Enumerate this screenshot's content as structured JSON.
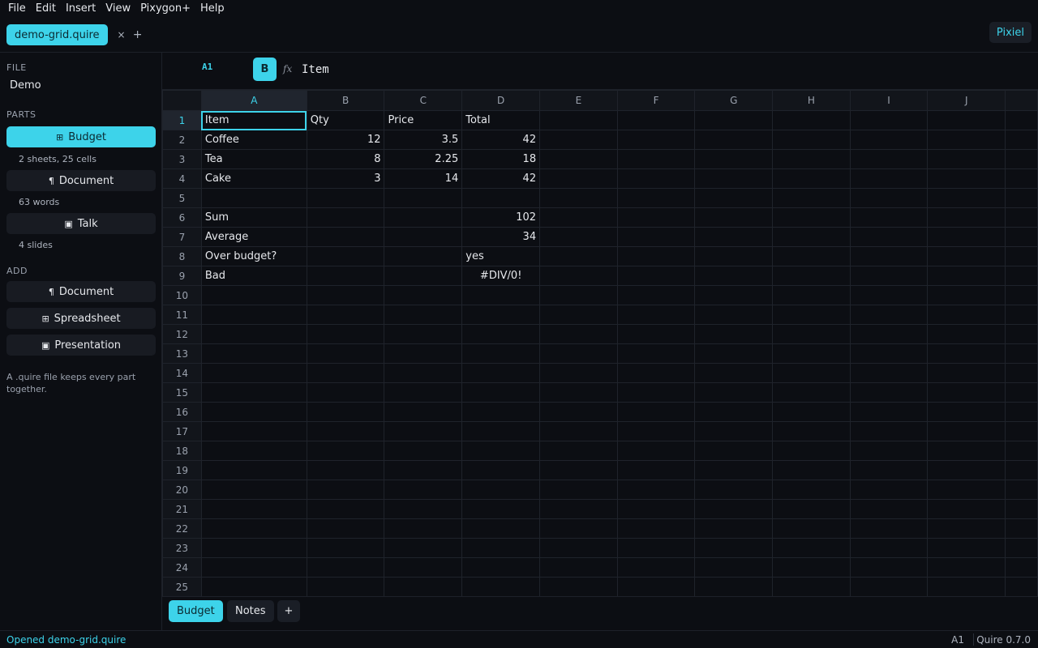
{
  "menubar": {
    "items": [
      "File",
      "Edit",
      "Insert",
      "View",
      "Pixygon+",
      "Help"
    ]
  },
  "tabs": {
    "active_tab": "demo-grid.quire",
    "close_symbol": "×",
    "add_symbol": "+",
    "user_label": "Pixiel"
  },
  "sidebar": {
    "file_label": "FILE",
    "file_name": "Demo",
    "parts_label": "PARTS",
    "parts": [
      {
        "label": "Budget",
        "icon": "spreadsheet-icon",
        "glyph": "⊞",
        "meta": "2 sheets, 25 cells",
        "active": true
      },
      {
        "label": "Document",
        "icon": "paragraph-icon",
        "glyph": "¶",
        "meta": "63 words",
        "active": false
      },
      {
        "label": "Talk",
        "icon": "presentation-icon",
        "glyph": "▣",
        "meta": "4 slides",
        "active": false
      }
    ],
    "add_label": "ADD",
    "add_items": [
      {
        "label": "Document",
        "icon": "paragraph-icon",
        "glyph": "¶"
      },
      {
        "label": "Spreadsheet",
        "icon": "spreadsheet-icon",
        "glyph": "⊞"
      },
      {
        "label": "Presentation",
        "icon": "presentation-icon",
        "glyph": "▣"
      }
    ],
    "note": "A .quire file keeps every part together."
  },
  "formula_bar": {
    "cell_ref": "A1",
    "bold_label": "B",
    "fx_label": "fx",
    "value": "Item"
  },
  "grid": {
    "columns": [
      "A",
      "B",
      "C",
      "D",
      "E",
      "F",
      "G",
      "H",
      "I",
      "J"
    ],
    "selected_column": "A",
    "selected_row": 1,
    "rows": [
      [
        "Item",
        "Qty",
        "Price",
        "Total",
        "",
        "",
        "",
        "",
        "",
        ""
      ],
      [
        "Coffee",
        "12",
        "3.5",
        "42",
        "",
        "",
        "",
        "",
        "",
        ""
      ],
      [
        "Tea",
        "8",
        "2.25",
        "18",
        "",
        "",
        "",
        "",
        "",
        ""
      ],
      [
        "Cake",
        "3",
        "14",
        "42",
        "",
        "",
        "",
        "",
        "",
        ""
      ],
      [
        "",
        "",
        "",
        "",
        "",
        "",
        "",
        "",
        "",
        ""
      ],
      [
        "Sum",
        "",
        "",
        "102",
        "",
        "",
        "",
        "",
        "",
        ""
      ],
      [
        "Average",
        "",
        "",
        "34",
        "",
        "",
        "",
        "",
        "",
        ""
      ],
      [
        "Over budget?",
        "",
        "",
        "yes",
        "",
        "",
        "",
        "",
        "",
        ""
      ],
      [
        "Bad",
        "",
        "",
        "#DIV/0!",
        "",
        "",
        "",
        "",
        "",
        ""
      ],
      [
        "",
        "",
        "",
        "",
        "",
        "",
        "",
        "",
        "",
        ""
      ],
      [
        "",
        "",
        "",
        "",
        "",
        "",
        "",
        "",
        "",
        ""
      ],
      [
        "",
        "",
        "",
        "",
        "",
        "",
        "",
        "",
        "",
        ""
      ],
      [
        "",
        "",
        "",
        "",
        "",
        "",
        "",
        "",
        "",
        ""
      ],
      [
        "",
        "",
        "",
        "",
        "",
        "",
        "",
        "",
        "",
        ""
      ],
      [
        "",
        "",
        "",
        "",
        "",
        "",
        "",
        "",
        "",
        ""
      ],
      [
        "",
        "",
        "",
        "",
        "",
        "",
        "",
        "",
        "",
        ""
      ],
      [
        "",
        "",
        "",
        "",
        "",
        "",
        "",
        "",
        "",
        ""
      ],
      [
        "",
        "",
        "",
        "",
        "",
        "",
        "",
        "",
        "",
        ""
      ],
      [
        "",
        "",
        "",
        "",
        "",
        "",
        "",
        "",
        "",
        ""
      ],
      [
        "",
        "",
        "",
        "",
        "",
        "",
        "",
        "",
        "",
        ""
      ],
      [
        "",
        "",
        "",
        "",
        "",
        "",
        "",
        "",
        "",
        ""
      ],
      [
        "",
        "",
        "",
        "",
        "",
        "",
        "",
        "",
        "",
        ""
      ],
      [
        "",
        "",
        "",
        "",
        "",
        "",
        "",
        "",
        "",
        ""
      ],
      [
        "",
        "",
        "",
        "",
        "",
        "",
        "",
        "",
        "",
        ""
      ],
      [
        "",
        "",
        "",
        "",
        "",
        "",
        "",
        "",
        "",
        ""
      ]
    ],
    "bold_cells": [
      "A1",
      "B1",
      "C1",
      "D1",
      "A6"
    ],
    "error_cells": [
      "D9"
    ],
    "left_aligned_cells": [
      "D8"
    ]
  },
  "sheet_tabs": {
    "tabs": [
      {
        "label": "Budget",
        "active": true
      },
      {
        "label": "Notes",
        "active": false
      }
    ],
    "add_symbol": "+"
  },
  "statusbar": {
    "message": "Opened demo-grid.quire",
    "cell_ref": "A1",
    "version": "Quire 0.7.0"
  },
  "colors": {
    "accent": "#3dd3ea",
    "error": "#e5484d",
    "background": "#0c0e13"
  }
}
